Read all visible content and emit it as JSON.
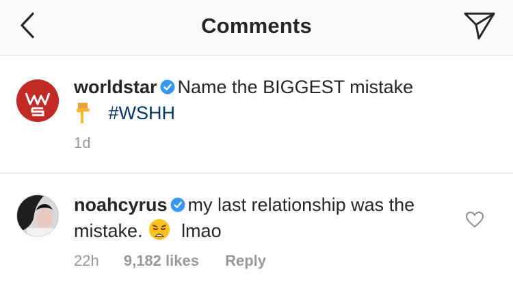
{
  "header": {
    "title": "Comments",
    "back_icon": "chevron-left-icon",
    "send_icon": "paper-plane-icon"
  },
  "post": {
    "username": "worldstar",
    "text_part1": "Name the BIGGEST mistake",
    "hashtag": "#WSHH",
    "emoji": "pointing-down-emoji",
    "time": "1d",
    "avatar_color": "#c22a26"
  },
  "comment": {
    "username": "noahcyrus",
    "text_part1": "my last relationship was the mistake.",
    "emoji": "weary-face-emoji",
    "text_part2": "lmao",
    "time": "22h",
    "likes": "9,182 likes",
    "reply_label": "Reply"
  },
  "colors": {
    "verified_blue": "#3897f0",
    "hashtag_blue": "#003569",
    "meta_gray": "#999999",
    "text": "#262626"
  }
}
